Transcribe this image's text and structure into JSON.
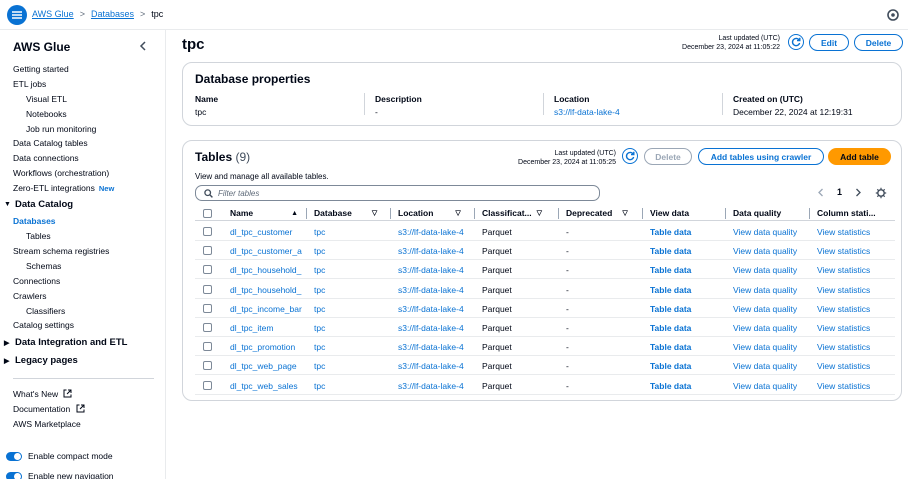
{
  "breadcrumb": {
    "items": [
      "AWS Glue",
      "Databases"
    ],
    "current": "tpc"
  },
  "sidebar": {
    "title": "AWS Glue",
    "items": [
      {
        "label": "Getting started"
      },
      {
        "label": "ETL jobs"
      },
      {
        "label": "Visual ETL"
      },
      {
        "label": "Notebooks"
      },
      {
        "label": "Job run monitoring"
      },
      {
        "label": "Data Catalog tables"
      },
      {
        "label": "Data connections"
      },
      {
        "label": "Workflows (orchestration)"
      },
      {
        "label": "Zero-ETL integrations",
        "badge": "New"
      }
    ],
    "data_catalog": {
      "label": "Data Catalog",
      "items": [
        "Databases",
        "Tables",
        "Stream schema registries",
        "Schemas",
        "Connections",
        "Crawlers",
        "Classifiers",
        "Catalog settings"
      ],
      "active": "Databases"
    },
    "sections": [
      "Data Integration and ETL",
      "Legacy pages"
    ],
    "links": [
      "What's New",
      "Documentation",
      "AWS Marketplace"
    ],
    "toggles": [
      "Enable compact mode",
      "Enable new navigation"
    ]
  },
  "header": {
    "title": "tpc",
    "last_updated_label": "Last updated (UTC)",
    "last_updated_value": "December 23, 2024 at 11:05:22",
    "edit_label": "Edit",
    "delete_label": "Delete"
  },
  "db_properties": {
    "title": "Database properties",
    "fields": [
      {
        "label": "Name",
        "value": "tpc"
      },
      {
        "label": "Description",
        "value": "-"
      },
      {
        "label": "Location",
        "value": "s3://lf-data-lake-4"
      },
      {
        "label": "Created on (UTC)",
        "value": "December 22, 2024 at 12:19:31"
      }
    ]
  },
  "tables": {
    "title": "Tables",
    "count": "(9)",
    "description": "View and manage all available tables.",
    "last_updated_label": "Last updated (UTC)",
    "last_updated_value": "December 23, 2024 at 11:05:25",
    "delete_label": "Delete",
    "crawler_label": "Add tables using crawler",
    "add_label": "Add table",
    "filter_placeholder": "Filter tables",
    "page": "1",
    "columns": [
      "Name",
      "Database",
      "Location",
      "Classificat...",
      "Deprecated",
      "View data",
      "Data quality",
      "Column stati..."
    ],
    "rows": [
      {
        "name": "dl_tpc_customer",
        "database": "tpc",
        "location": "s3://lf-data-lake-4",
        "classification": "Parquet",
        "deprecated": "-",
        "view": "Table data",
        "quality": "View data quality",
        "stats": "View statistics"
      },
      {
        "name": "dl_tpc_customer_a",
        "database": "tpc",
        "location": "s3://lf-data-lake-4",
        "classification": "Parquet",
        "deprecated": "-",
        "view": "Table data",
        "quality": "View data quality",
        "stats": "View statistics"
      },
      {
        "name": "dl_tpc_household_",
        "database": "tpc",
        "location": "s3://lf-data-lake-4",
        "classification": "Parquet",
        "deprecated": "-",
        "view": "Table data",
        "quality": "View data quality",
        "stats": "View statistics"
      },
      {
        "name": "dl_tpc_household_",
        "database": "tpc",
        "location": "s3://lf-data-lake-4",
        "classification": "Parquet",
        "deprecated": "-",
        "view": "Table data",
        "quality": "View data quality",
        "stats": "View statistics"
      },
      {
        "name": "dl_tpc_income_bar",
        "database": "tpc",
        "location": "s3://lf-data-lake-4",
        "classification": "Parquet",
        "deprecated": "-",
        "view": "Table data",
        "quality": "View data quality",
        "stats": "View statistics"
      },
      {
        "name": "dl_tpc_item",
        "database": "tpc",
        "location": "s3://lf-data-lake-4",
        "classification": "Parquet",
        "deprecated": "-",
        "view": "Table data",
        "quality": "View data quality",
        "stats": "View statistics"
      },
      {
        "name": "dl_tpc_promotion",
        "database": "tpc",
        "location": "s3://lf-data-lake-4",
        "classification": "Parquet",
        "deprecated": "-",
        "view": "Table data",
        "quality": "View data quality",
        "stats": "View statistics"
      },
      {
        "name": "dl_tpc_web_page",
        "database": "tpc",
        "location": "s3://lf-data-lake-4",
        "classification": "Parquet",
        "deprecated": "-",
        "view": "Table data",
        "quality": "View data quality",
        "stats": "View statistics"
      },
      {
        "name": "dl_tpc_web_sales",
        "database": "tpc",
        "location": "s3://lf-data-lake-4",
        "classification": "Parquet",
        "deprecated": "-",
        "view": "Table data",
        "quality": "View data quality",
        "stats": "View statistics"
      }
    ]
  },
  "icons": [
    "menu-icon",
    "settings-icon",
    "collapse-chevron-icon",
    "refresh-icon",
    "search-icon",
    "external-link-icon",
    "sort-ascending-icon",
    "filter-caret-icon",
    "chevron-left-icon",
    "chevron-right-icon",
    "gear-icon"
  ],
  "colors": {
    "accent": "#0972d3",
    "primary_button": "#ff9900",
    "text": "#000716",
    "border": "#d1d5db"
  }
}
